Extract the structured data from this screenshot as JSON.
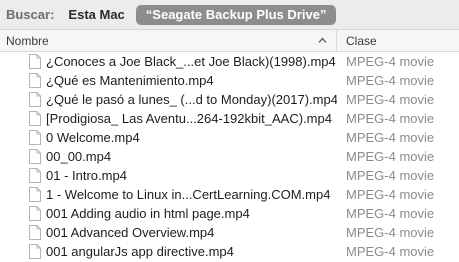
{
  "scope_bar": {
    "label": "Buscar:",
    "this_mac": "Esta Mac",
    "selected_scope": "“Seagate Backup Plus Drive”"
  },
  "columns": {
    "name": "Nombre",
    "kind": "Clase",
    "sort_icon": "chevron-up-icon"
  },
  "files": [
    {
      "name": "¿Conoces a Joe Black_...et Joe Black)(1998).mp4",
      "kind": "MPEG-4 movie"
    },
    {
      "name": "¿Qué es Mantenimiento.mp4",
      "kind": "MPEG-4 movie"
    },
    {
      "name": "¿Qué le pasó a lunes_ (...d to Monday)(2017).mp4",
      "kind": "MPEG-4 movie"
    },
    {
      "name": "[Prodigiosa_ Las Aventu...264-192kbit_AAC).mp4",
      "kind": "MPEG-4 movie"
    },
    {
      "name": "0 Welcome.mp4",
      "kind": "MPEG-4 movie"
    },
    {
      "name": "00_00.mp4",
      "kind": "MPEG-4 movie"
    },
    {
      "name": "01 - Intro.mp4",
      "kind": "MPEG-4 movie"
    },
    {
      "name": "1 - Welcome to Linux in...CertLearning.COM.mp4",
      "kind": "MPEG-4 movie"
    },
    {
      "name": "001 Adding audio in html page.mp4",
      "kind": "MPEG-4 movie"
    },
    {
      "name": "001 Advanced Overview.mp4",
      "kind": "MPEG-4 movie"
    },
    {
      "name": "001 angularJs app directive.mp4",
      "kind": "MPEG-4 movie"
    }
  ],
  "file_icon": "document-icon"
}
